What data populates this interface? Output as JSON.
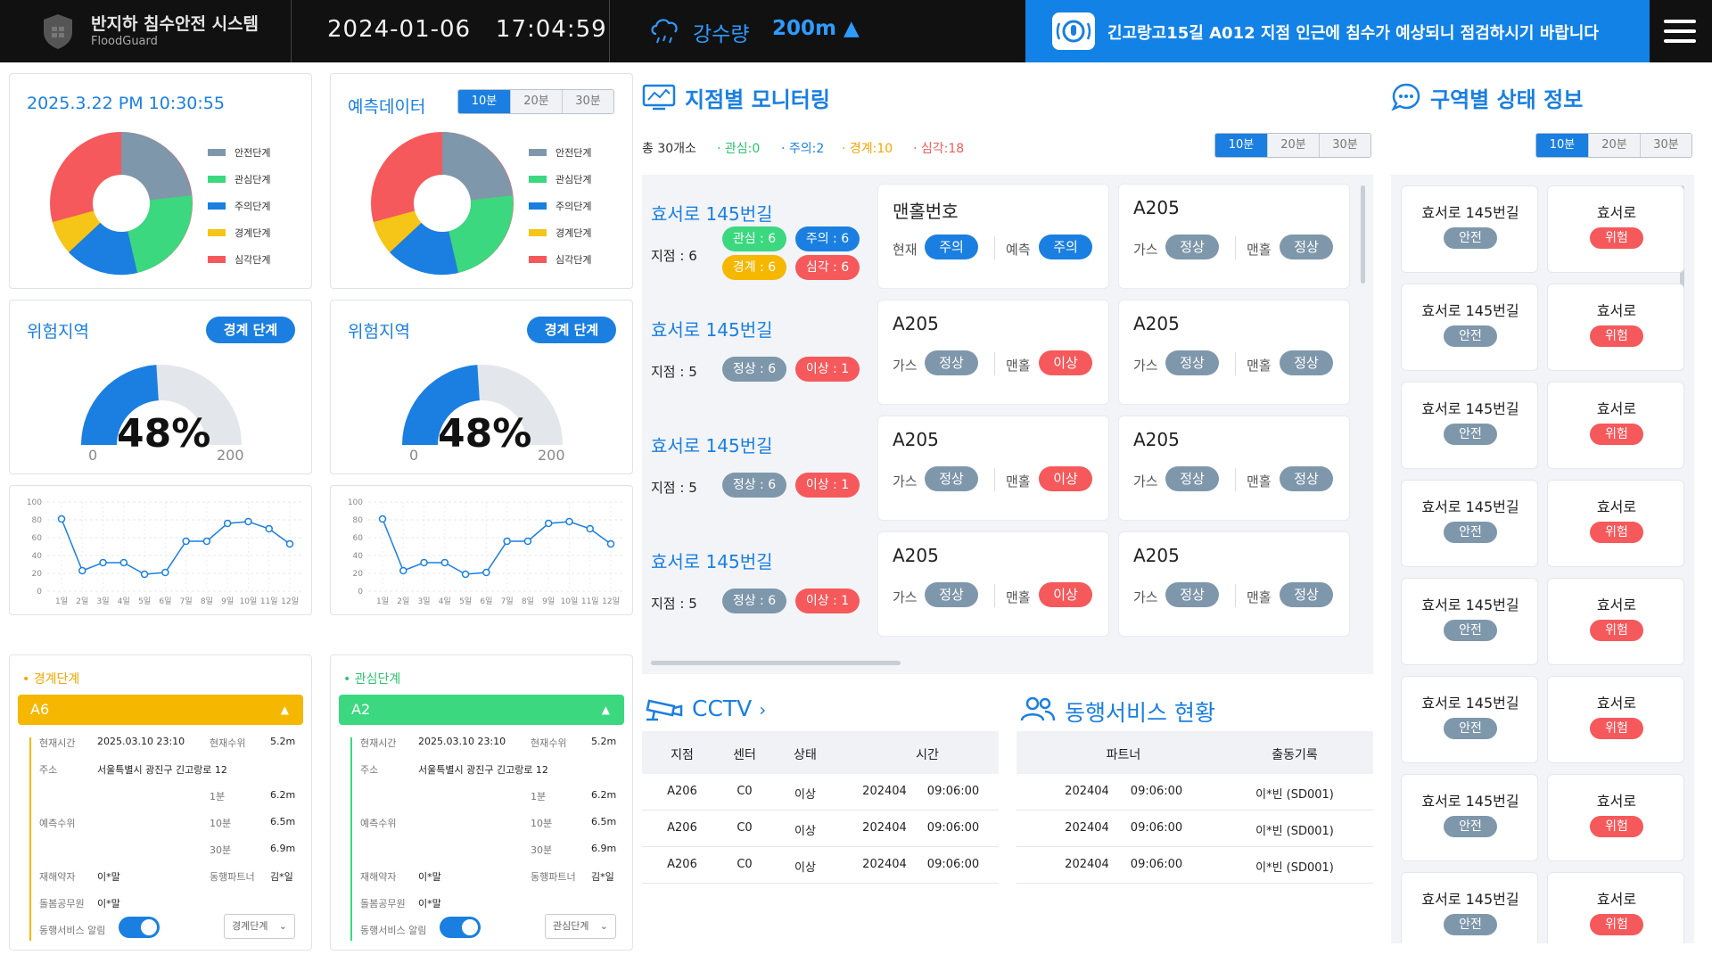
{
  "topbar": {
    "title": "반지하 침수안전 시스템",
    "subtitle": "FloodGuard",
    "date": "2024-01-06",
    "time": "17:04:59",
    "rain_label": "강수량",
    "rain_value": "200m ▲",
    "alert_text": "긴고랑고15길 A012 지점 인근에 침수가 예상되니 점검하시기 바랍니다"
  },
  "colors": {
    "accent": "#1a7fe0",
    "safe": "#7f97ab",
    "interest": "#3bd87f",
    "caution": "#1a7fe0",
    "alert": "#f5b700",
    "severe": "#f5595b"
  },
  "pie_left": {
    "title": "2025.3.22 PM 10:30:55",
    "legend": [
      "안전단계",
      "관심단계",
      "주의단계",
      "경계단계",
      "심각단계"
    ]
  },
  "pie_right": {
    "title": "예측데이터",
    "tabs": [
      "10분",
      "20분",
      "30분"
    ],
    "legend": [
      "안전단계",
      "관심단계",
      "주의단계",
      "경계단계",
      "심각단계"
    ]
  },
  "gauge_left": {
    "title": "위험지역",
    "badge": "경계 단계",
    "percent": "48%",
    "min": "0",
    "max": "200",
    "level": 0.48
  },
  "gauge_right": {
    "title": "위험지역",
    "badge": "경계 단계",
    "percent": "48%",
    "min": "0",
    "max": "200",
    "level": 0.48
  },
  "chart_data": [
    {
      "type": "line",
      "x": [
        "1일",
        "2일",
        "3일",
        "4일",
        "5일",
        "6일",
        "7일",
        "8일",
        "9일",
        "10일",
        "11일",
        "12일"
      ],
      "values": [
        81,
        23,
        32,
        32,
        19,
        21,
        56,
        56,
        76,
        78,
        70,
        53
      ],
      "ylim": [
        0,
        100
      ],
      "yticks": [
        "0",
        "20",
        "40",
        "60",
        "80",
        "100"
      ]
    },
    {
      "type": "line",
      "x": [
        "1일",
        "2일",
        "3일",
        "4일",
        "5일",
        "6일",
        "7일",
        "8일",
        "9일",
        "10일",
        "11일",
        "12일"
      ],
      "values": [
        81,
        23,
        32,
        32,
        19,
        21,
        56,
        56,
        76,
        78,
        70,
        53
      ],
      "ylim": [
        0,
        100
      ],
      "yticks": [
        "0",
        "20",
        "40",
        "60",
        "80",
        "100"
      ]
    }
  ],
  "stage_left": {
    "header": "• 경계단계",
    "bar": "A6",
    "now_time_label": "현재시간",
    "now_time": "2025.03.10 23:10",
    "now_level_label": "현재수위",
    "now_level": "5.2m",
    "addr_label": "주소",
    "addr": "서울특별시 광진구 긴고랑로 12",
    "pred_label": "예측수위",
    "pred": [
      {
        "k": "1분",
        "v": "6.2m"
      },
      {
        "k": "10분",
        "v": "6.5m"
      },
      {
        "k": "30분",
        "v": "6.9m"
      }
    ],
    "weak_label": "재해약자",
    "weak": "이*말",
    "partner_label": "동행파트너",
    "partner": "김*일",
    "care_label": "돌봄공무원",
    "care": "이*말",
    "notify_label": "동행서비스 알림",
    "select": "경계단계"
  },
  "stage_right": {
    "header": "• 관심단계",
    "bar": "A2",
    "now_time_label": "현재시간",
    "now_time": "2025.03.10 23:10",
    "now_level_label": "현재수위",
    "now_level": "5.2m",
    "addr_label": "주소",
    "addr": "서울특별시 광진구 긴고랑로 12",
    "pred_label": "예측수위",
    "pred": [
      {
        "k": "1분",
        "v": "6.2m"
      },
      {
        "k": "10분",
        "v": "6.5m"
      },
      {
        "k": "30분",
        "v": "6.9m"
      }
    ],
    "weak_label": "재해약자",
    "weak": "이*말",
    "partner_label": "동행파트너",
    "partner": "김*일",
    "care_label": "돌봄공무원",
    "care": "이*말",
    "notify_label": "동행서비스 알림",
    "select": "관심단계"
  },
  "monitor": {
    "title": "지점별 모니터링",
    "total": "총 30개소",
    "counts": [
      "· 관심:0",
      "· 주의:2",
      "· 경계:10",
      "· 심각:18"
    ],
    "tabs": [
      "10분",
      "20분",
      "30분"
    ],
    "rows": [
      {
        "name": "효서로 145번길",
        "points": "지점 : 6",
        "pills": [
          "관심 : 6",
          "주의 : 6",
          "경계 : 6",
          "심각 : 6"
        ],
        "cards": [
          {
            "name": "맨홀번호",
            "l1": "현재",
            "p1": "주의",
            "l2": "예측",
            "p2": "주의"
          },
          {
            "name": "A205",
            "l1": "가스",
            "p1": "정상",
            "l2": "맨홀",
            "p2": "정상"
          }
        ]
      },
      {
        "name": "효서로 145번길",
        "points": "지점 : 5",
        "pills": [
          "정상 : 6",
          "이상 : 1"
        ],
        "cards": [
          {
            "name": "A205",
            "l1": "가스",
            "p1": "정상",
            "l2": "맨홀",
            "p2": "이상"
          },
          {
            "name": "A205",
            "l1": "가스",
            "p1": "정상",
            "l2": "맨홀",
            "p2": "정상"
          }
        ]
      },
      {
        "name": "효서로 145번길",
        "points": "지점 : 5",
        "pills": [
          "정상 : 6",
          "이상 : 1"
        ],
        "cards": [
          {
            "name": "A205",
            "l1": "가스",
            "p1": "정상",
            "l2": "맨홀",
            "p2": "이상"
          },
          {
            "name": "A205",
            "l1": "가스",
            "p1": "정상",
            "l2": "맨홀",
            "p2": "정상"
          }
        ]
      },
      {
        "name": "효서로 145번길",
        "points": "지점 : 5",
        "pills": [
          "정상 : 6",
          "이상 : 1"
        ],
        "cards": [
          {
            "name": "A205",
            "l1": "가스",
            "p1": "정상",
            "l2": "맨홀",
            "p2": "이상"
          },
          {
            "name": "A205",
            "l1": "가스",
            "p1": "정상",
            "l2": "맨홀",
            "p2": "정상"
          }
        ]
      }
    ]
  },
  "cctv": {
    "title": "CCTV",
    "headers": [
      "지점",
      "센터",
      "상태",
      "시간"
    ],
    "rows": [
      [
        "A206",
        "C0",
        "이상",
        "202404",
        "09:06:00"
      ],
      [
        "A206",
        "C0",
        "이상",
        "202404",
        "09:06:00"
      ],
      [
        "A206",
        "C0",
        "이상",
        "202404",
        "09:06:00"
      ]
    ]
  },
  "companion": {
    "title": "동행서비스 현황",
    "headers": [
      "파트너",
      "출동기록"
    ],
    "rows": [
      [
        "202404",
        "09:06:00",
        "이*빈 (SD001)"
      ],
      [
        "202404",
        "09:06:00",
        "이*빈 (SD001)"
      ],
      [
        "202404",
        "09:06:00",
        "이*빈 (SD001)"
      ]
    ]
  },
  "zones": {
    "title": "구역별 상태 정보",
    "tabs": [
      "10분",
      "20분",
      "30분"
    ],
    "left": [
      {
        "name": "효서로 145번길",
        "status": "안전"
      },
      {
        "name": "효서로 145번길",
        "status": "안전"
      },
      {
        "name": "효서로 145번길",
        "status": "안전"
      },
      {
        "name": "효서로 145번길",
        "status": "안전"
      },
      {
        "name": "효서로 145번길",
        "status": "안전"
      },
      {
        "name": "효서로 145번길",
        "status": "안전"
      },
      {
        "name": "효서로 145번길",
        "status": "안전"
      },
      {
        "name": "효서로 145번길",
        "status": "안전"
      }
    ],
    "right": [
      {
        "name": "효서로",
        "status": "위험"
      },
      {
        "name": "효서로",
        "status": "위험"
      },
      {
        "name": "효서로",
        "status": "위험"
      },
      {
        "name": "효서로",
        "status": "위험"
      },
      {
        "name": "효서로",
        "status": "위험"
      },
      {
        "name": "효서로",
        "status": "위험"
      },
      {
        "name": "효서로",
        "status": "위험"
      },
      {
        "name": "효서로",
        "status": "위험"
      }
    ]
  }
}
